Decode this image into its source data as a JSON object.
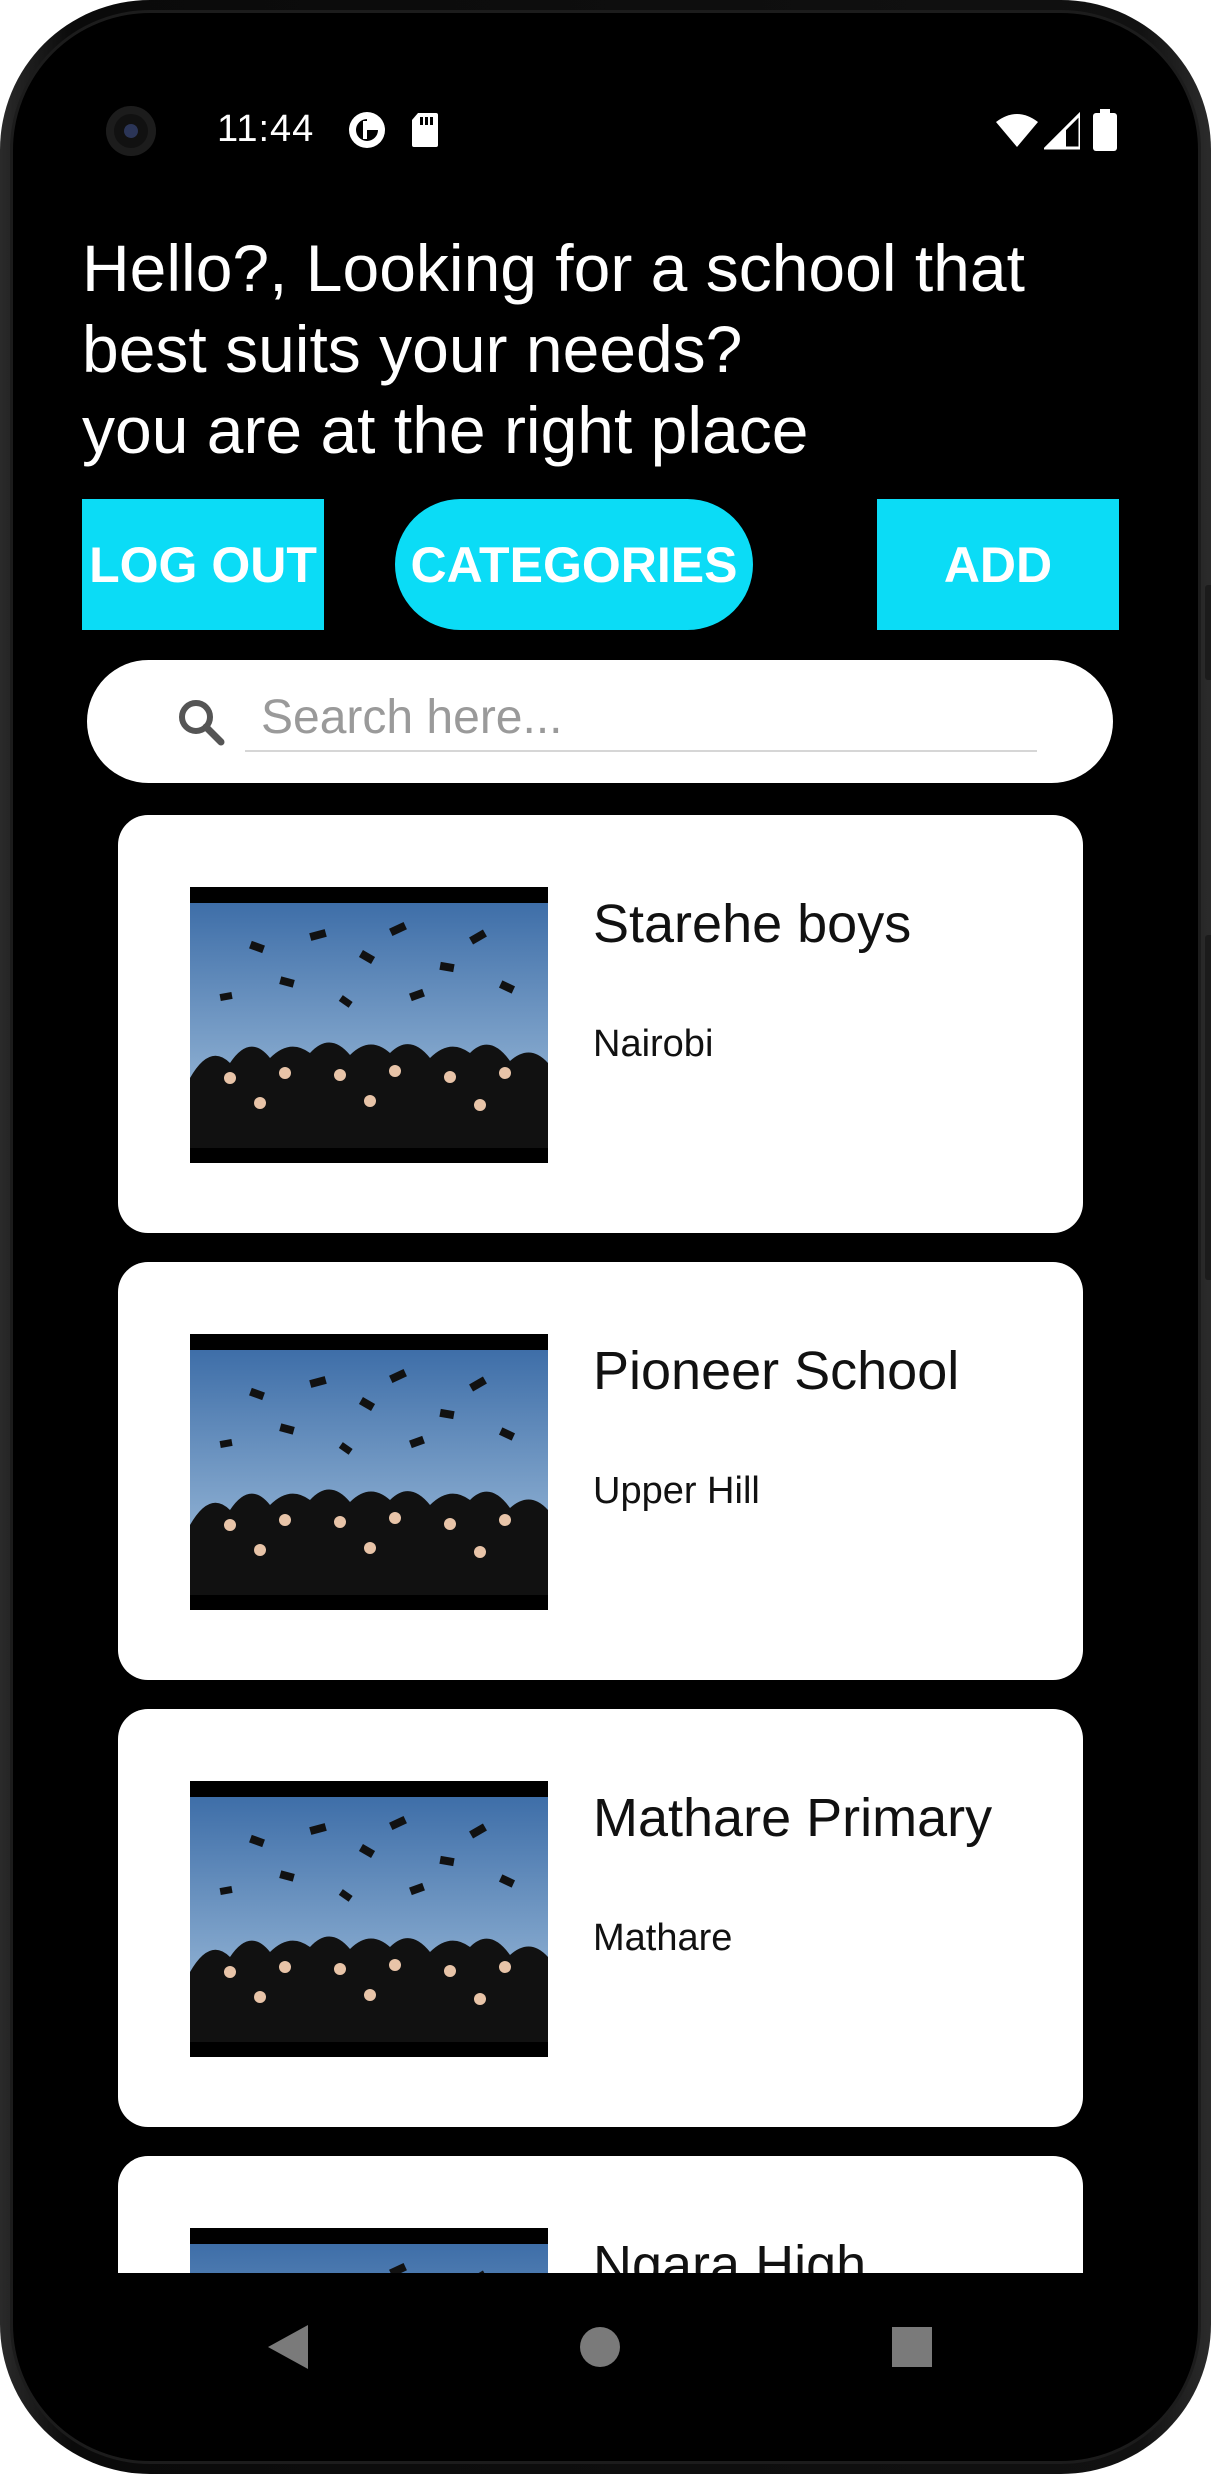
{
  "status_bar": {
    "time": "11:44",
    "icons": [
      "data-saver-icon",
      "sd-card-icon",
      "wifi-icon",
      "signal-icon",
      "battery-icon"
    ]
  },
  "greeting": "Hello?, Looking for a school that\nbest suits your needs?\nyou are at the right place",
  "buttons": {
    "logout": "LOG OUT",
    "categories": "CATEGORIES",
    "add": "ADD"
  },
  "search": {
    "placeholder": "Search here...",
    "value": ""
  },
  "schools": [
    {
      "name": "Starehe boys",
      "location": "Nairobi"
    },
    {
      "name": "Pioneer School",
      "location": "Upper Hill"
    },
    {
      "name": "Mathare Primary",
      "location": "Mathare"
    },
    {
      "name": "Ngara High",
      "location": ""
    }
  ],
  "colors": {
    "accent": "#0bdcf6",
    "background": "#000000",
    "card": "#ffffff"
  }
}
